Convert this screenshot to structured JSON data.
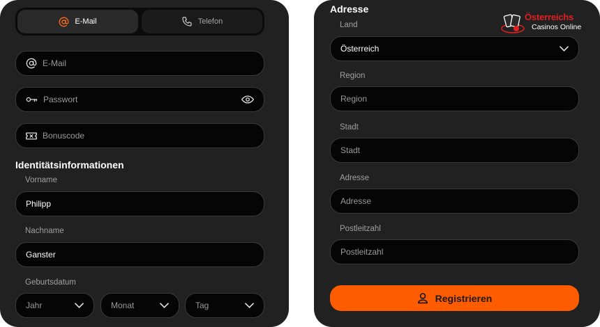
{
  "tabs": {
    "email": "E-Mail",
    "phone": "Telefon"
  },
  "account": {
    "email_placeholder": "E-Mail",
    "password_placeholder": "Passwort",
    "bonus_placeholder": "Bonuscode"
  },
  "identity": {
    "heading": "Identitätsinformationen",
    "firstname_label": "Vorname",
    "firstname_value": "Philipp",
    "lastname_label": "Nachname",
    "lastname_value": "Ganster",
    "birthdate_label": "Geburtsdatum",
    "year": "Jahr",
    "month": "Monat",
    "day": "Tag"
  },
  "address": {
    "heading": "Adresse",
    "country_label": "Land",
    "country_value": "Österreich",
    "region_label": "Region",
    "region_placeholder": "Region",
    "city_label": "Stadt",
    "city_placeholder": "Stadt",
    "street_label": "Adresse",
    "street_placeholder": "Adresse",
    "zip_label": "Postleitzahl",
    "zip_placeholder": "Postleitzahl"
  },
  "submit": {
    "label": "Registrieren"
  },
  "logo": {
    "line1": "Österreichs",
    "line2": "Casinos Online"
  },
  "colors": {
    "accent": "#ff5c00",
    "email_icon": "#ff6a1a",
    "logo_red": "#e02020",
    "panel_bg": "#212121",
    "field_bg": "#050505"
  }
}
